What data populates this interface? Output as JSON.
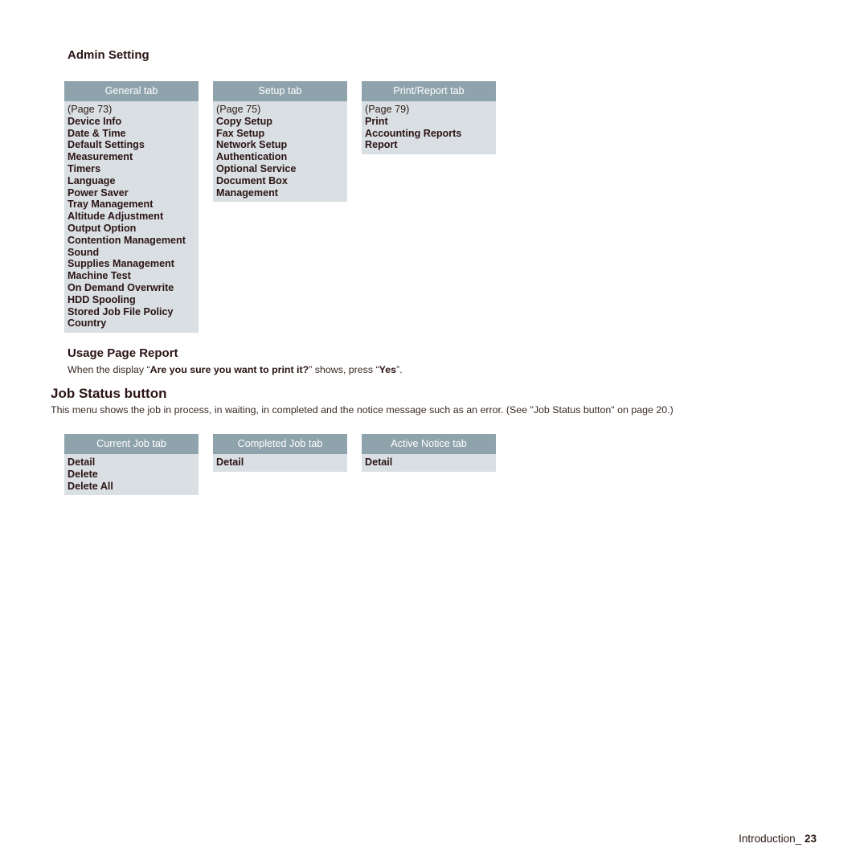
{
  "admin_setting": {
    "heading": "Admin Setting",
    "tabs": [
      {
        "label": "General tab",
        "page": "(Page 73)",
        "items": [
          "Device Info",
          "Date & Time",
          "Default Settings",
          "Measurement",
          "Timers",
          "Language",
          "Power Saver",
          "Tray Management",
          "Altitude Adjustment",
          "Output Option",
          "Contention Management",
          "Sound",
          "Supplies Management",
          "Machine Test",
          "On Demand Overwrite",
          "HDD Spooling",
          "Stored Job File Policy",
          "Country"
        ]
      },
      {
        "label": "Setup tab",
        "page": "(Page 75)",
        "items": [
          "Copy Setup",
          "Fax Setup",
          "Network Setup",
          "Authentication",
          "Optional Service",
          "Document Box",
          "Management"
        ]
      },
      {
        "label": "Print/Report tab",
        "page": "(Page 79)",
        "items": [
          "Print",
          "Accounting Reports",
          "Report"
        ]
      }
    ]
  },
  "usage_page_report": {
    "heading": "Usage Page Report",
    "text_before": "When the display “",
    "bold_prompt": "Are you sure you want to print it?",
    "text_middle": "” shows, press “",
    "bold_button": "Yes",
    "text_after": "”."
  },
  "job_status": {
    "heading": "Job Status button",
    "description": "This menu shows the job in process, in waiting, in completed and the notice message such as an error. (See \"Job Status button\" on page 20.)",
    "tabs": [
      {
        "label": "Current Job tab",
        "items": [
          "Detail",
          "Delete",
          "Delete All"
        ]
      },
      {
        "label": "Completed Job tab",
        "items": [
          "Detail"
        ]
      },
      {
        "label": "Active Notice tab",
        "items": [
          "Detail"
        ]
      }
    ]
  },
  "footer": {
    "section": "Introduction_",
    "page_number": "23"
  },
  "colors": {
    "tab_header_bg": "#8fa3ad",
    "tab_body_bg": "#d9dfe3",
    "text": "#2b1414"
  }
}
